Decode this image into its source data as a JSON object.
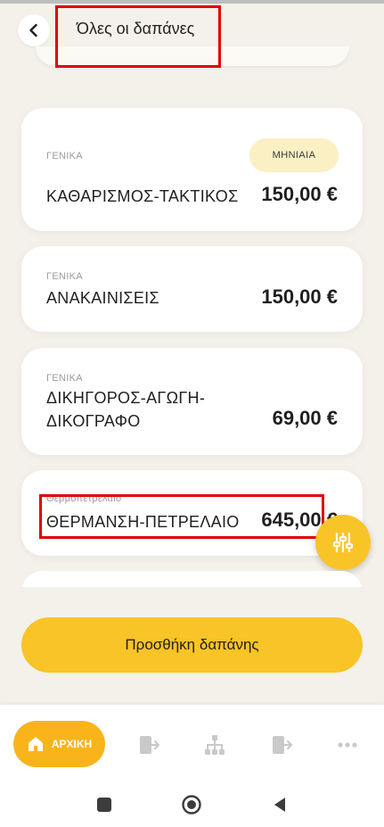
{
  "header": {
    "title": "Όλες οι δαπάνες"
  },
  "expenses": [
    {
      "category": "ΓΕΝΙΚΑ",
      "badge": "ΜΗΝΙΑΙΑ",
      "title_line1": "ΚΑΘΑΡΙΣΜΟΣ-ΤΑΚΤΙΚΟΣ",
      "amount": "150,00 €"
    },
    {
      "category": "ΓΕΝΙΚΑ",
      "title_line1": "ΑΝΑΚΑΙΝΙΣΕΙΣ",
      "amount": "150,00 €"
    },
    {
      "category": "ΓΕΝΙΚΑ",
      "title_line1": "ΔΙΚΗΓΟΡΟΣ-ΑΓΩΓΗ-",
      "title_line2": "ΔΙΚΟΓΡΑΦΟ",
      "amount": "69,00 €"
    },
    {
      "category": "Θερμοπετρελαιο",
      "title_line1": "ΘΕΡΜΑΝΣΗ-ΠΕΤΡΕΛΑΙΟ",
      "amount": "645,00 €"
    }
  ],
  "actions": {
    "add_expense": "Προσθήκη δαπάνης"
  },
  "bottom_nav": {
    "home_label": "ΑΡΧΙΚΗ",
    "items": [
      "home-icon",
      "exit-door-icon",
      "hierarchy-icon",
      "exit-door-icon",
      "more-icon"
    ]
  },
  "colors": {
    "accent": "#f9c427",
    "nav_active": "#f9b41b",
    "background": "#f4f1ea",
    "badge_bg": "#fbefc4",
    "highlight": "#e10000"
  }
}
